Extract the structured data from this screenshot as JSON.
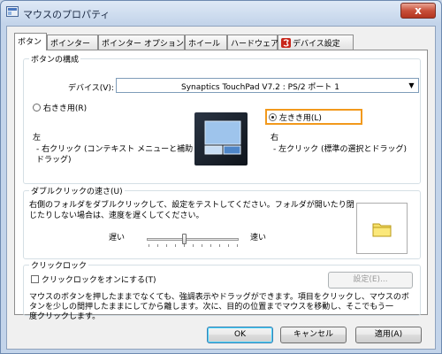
{
  "window": {
    "title": "マウスのプロパティ",
    "close_label": "x"
  },
  "tabs": [
    {
      "label": "ボタン"
    },
    {
      "label": "ポインター"
    },
    {
      "label": "ポインター オプション"
    },
    {
      "label": "ホイール"
    },
    {
      "label": "ハードウェア"
    },
    {
      "label": "デバイス設定"
    }
  ],
  "buttons_group": {
    "title": "ボタンの構成",
    "device_label": "デバイス(V):",
    "device_value": "Synaptics TouchPad V7.2 : PS/2 ポート 1",
    "right_handed_label": "右きき用(R)",
    "left_handed_label": "左きき用(L)",
    "selected": "left",
    "left_col": {
      "title": "左",
      "desc_1": "- 右クリック (コンテキスト メニューと補助",
      "desc_2": "ドラッグ)"
    },
    "right_col": {
      "title": "右",
      "desc_1": "- 左クリック (標準の選択とドラッグ)"
    }
  },
  "double_click": {
    "title": "ダブルクリックの速さ(U)",
    "desc_1": "右側のフォルダをダブルクリックして、設定をテストしてください。フォルダが開いたり閉",
    "desc_2": "じたりしない場合は、速度を遅くしてください。",
    "slow_label": "遅い",
    "fast_label": "速い",
    "speed_fraction": 0.4
  },
  "click_lock": {
    "title": "クリックロック",
    "checkbox_label": "クリックロックをオンにする(T)",
    "checked": false,
    "settings_label": "設定(E)...",
    "desc_1": "マウスのボタンを押したままでなくても、強調表示やドラッグができます。項目をクリックし、マウスのボ",
    "desc_2": "タンを少しの間押したままにしてから離します。次に、目的の位置までマウスを移動し、そこでもう一",
    "desc_3": "度クリックします。"
  },
  "footer": {
    "ok_label": "OK",
    "cancel_label": "キャンセル",
    "apply_label": "適用(A)"
  }
}
